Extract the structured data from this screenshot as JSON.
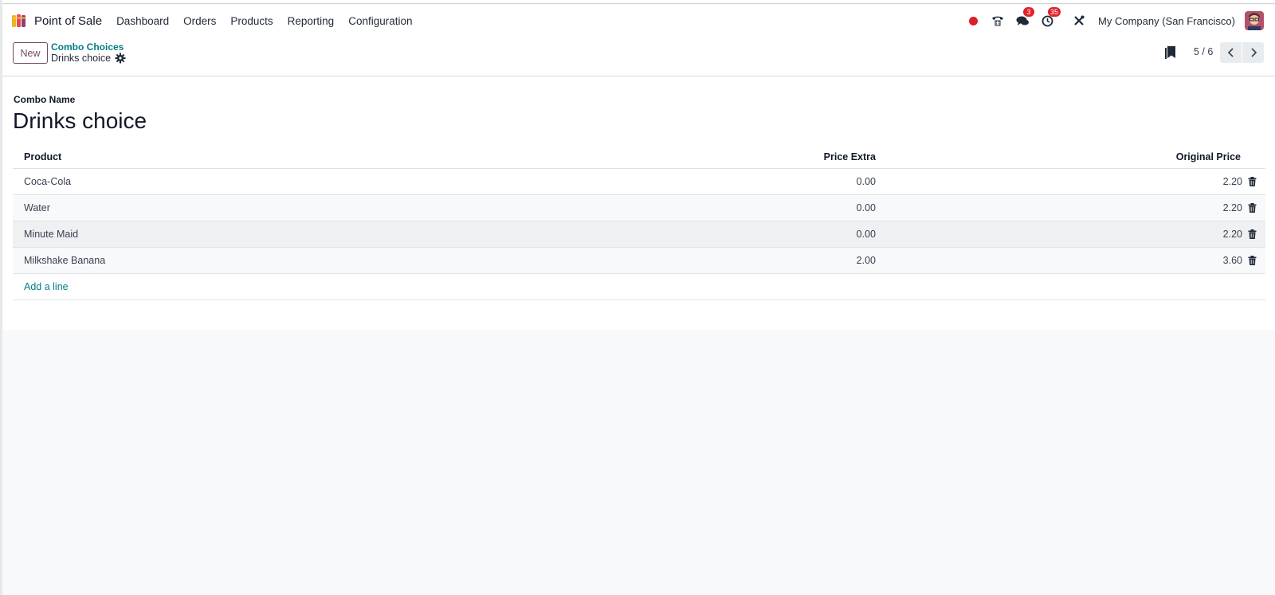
{
  "navbar": {
    "app_name": "Point of Sale",
    "menu": [
      "Dashboard",
      "Orders",
      "Products",
      "Reporting",
      "Configuration"
    ],
    "messages_badge": "3",
    "activities_badge": "35",
    "company": "My Company (San Francisco)",
    "icons": [
      "record-dot-icon",
      "phone-icon",
      "chat-icon",
      "clock-icon",
      "tools-icon"
    ]
  },
  "control_panel": {
    "new_label": "New",
    "breadcrumb": "Combo Choices",
    "record_title": "Drinks choice",
    "pager": "5 / 6"
  },
  "form": {
    "field_label": "Combo Name",
    "combo_name": "Drinks choice",
    "columns": [
      "Product",
      "Price Extra",
      "Original Price"
    ],
    "rows": [
      {
        "product": "Coca-Cola",
        "price_extra": "0.00",
        "original_price": "2.20"
      },
      {
        "product": "Water",
        "price_extra": "0.00",
        "original_price": "2.20"
      },
      {
        "product": "Minute Maid",
        "price_extra": "0.00",
        "original_price": "2.20"
      },
      {
        "product": "Milkshake Banana",
        "price_extra": "2.00",
        "original_price": "3.60"
      }
    ],
    "add_line": "Add a line"
  },
  "colors": {
    "accent": "#714b67",
    "link": "#017e84",
    "badge": "#e0212b"
  }
}
